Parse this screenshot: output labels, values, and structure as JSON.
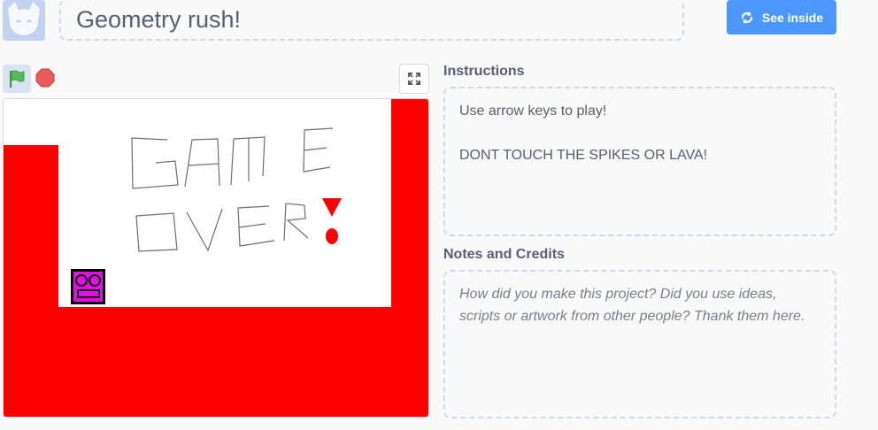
{
  "header": {
    "title": "Geometry rush!",
    "see_inside_label": "See inside"
  },
  "controls": {
    "green_flag": "green-flag-icon",
    "stop": "stop-icon",
    "fullscreen": "fullscreen-icon"
  },
  "instructions": {
    "label": "Instructions",
    "text": "Use arrow keys to play!\n\nDONT TOUCH THE SPIKES OR LAVA!"
  },
  "notes": {
    "label": "Notes and Credits",
    "placeholder": "How did you make this project? Did you use ideas, scripts or artwork from other people? Thank them here."
  },
  "stage": {
    "game_over_text": "GAME OVER!",
    "lava_color": "#ff0000",
    "player_color": "#e60ce6"
  },
  "colors": {
    "accent": "#4c97ff",
    "text": "#575e75",
    "dashed_border": "#c8d9f2"
  }
}
